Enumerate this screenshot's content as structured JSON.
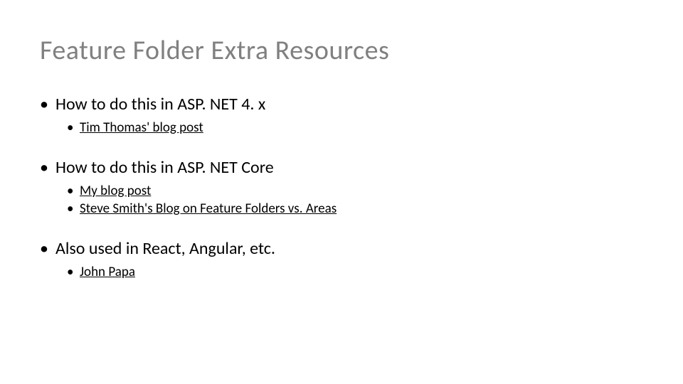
{
  "title": "Feature Folder Extra Resources",
  "sections": [
    {
      "heading": "How to do this in ASP. NET 4. x",
      "links": [
        "Tim Thomas' blog post"
      ]
    },
    {
      "heading": "How to do this in ASP. NET Core",
      "links": [
        "My blog post",
        "Steve Smith's Blog on Feature Folders vs. Areas"
      ]
    },
    {
      "heading": "Also used in React, Angular, etc.",
      "links": [
        "John Papa"
      ]
    }
  ]
}
